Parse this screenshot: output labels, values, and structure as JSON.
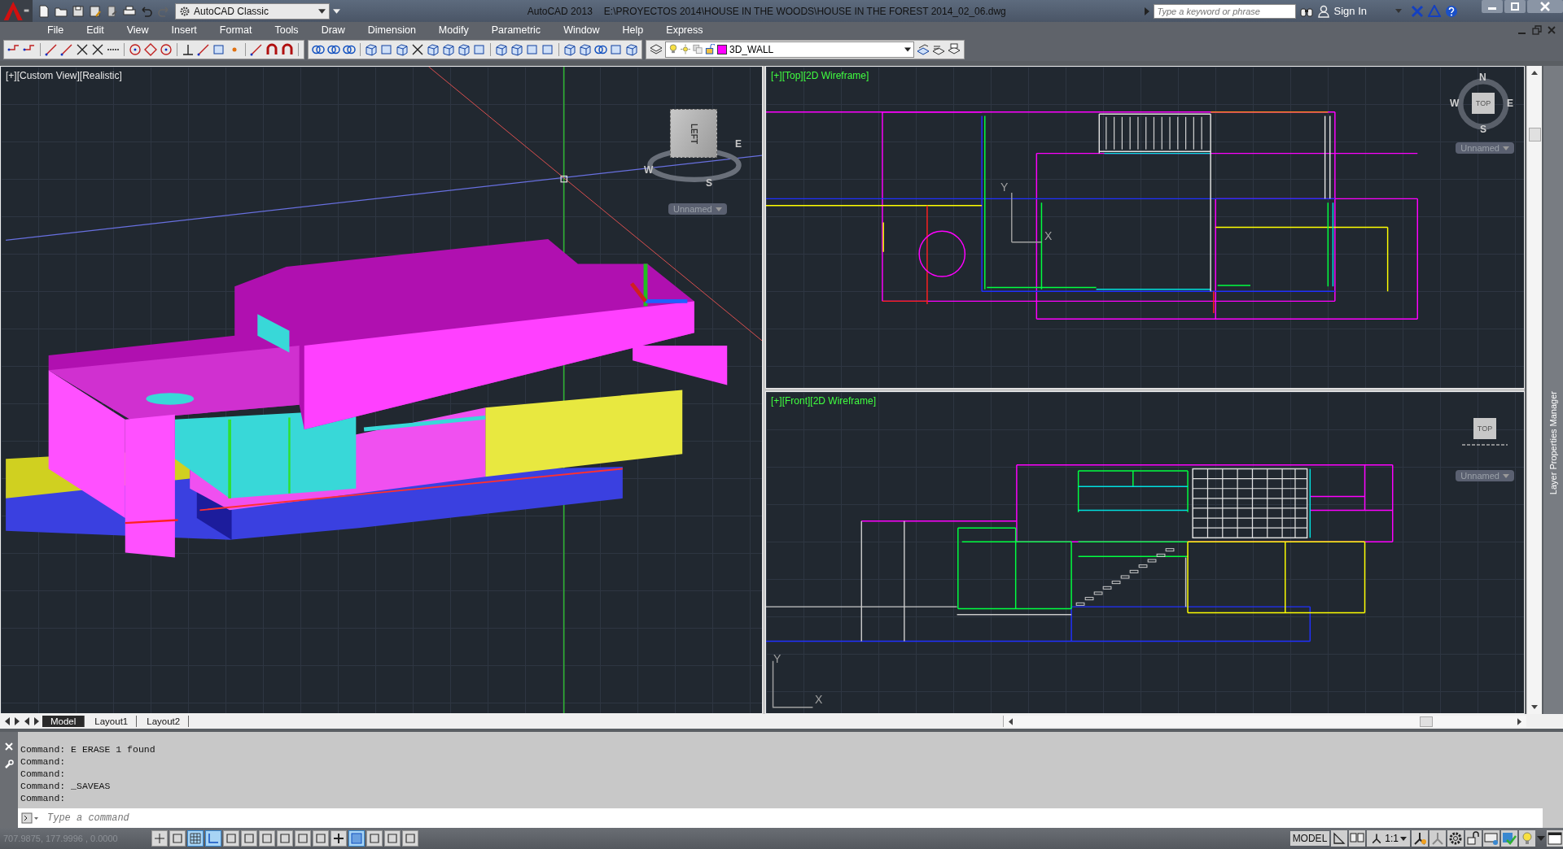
{
  "window": {
    "workspace": "AutoCAD Classic",
    "app_name": "AutoCAD 2013",
    "file_path": "E:\\PROYECTOS 2014\\HOUSE IN THE WOODS\\HOUSE IN THE FOREST 2014_02_06.dwg"
  },
  "search": {
    "placeholder": "Type a keyword or phrase"
  },
  "sign_in": "Sign In",
  "menu": [
    "File",
    "Edit",
    "View",
    "Insert",
    "Format",
    "Tools",
    "Draw",
    "Dimension",
    "Modify",
    "Parametric",
    "Window",
    "Help",
    "Express"
  ],
  "layer": {
    "name": "3D_WALL"
  },
  "viewports": [
    {
      "label": "[+][Custom View][Realistic]",
      "cube_face": "LEFT",
      "compass": [
        "W",
        "S",
        "E"
      ],
      "named_view": "Unnamed"
    },
    {
      "label": "[+][Top][2D Wireframe]",
      "cube_face": "TOP",
      "compass": [
        "N",
        "W",
        "E",
        "S"
      ],
      "named_view": "Unnamed",
      "ucs": {
        "x": "X",
        "y": "Y"
      }
    },
    {
      "label": "[+][Front][2D Wireframe]",
      "cube_face": "TOP",
      "named_view": "Unnamed",
      "ucs": {
        "x": "X",
        "y": "Y"
      }
    }
  ],
  "layout_tabs": [
    {
      "label": "Model",
      "selected": true
    },
    {
      "label": "Layout1",
      "selected": false
    },
    {
      "label": "Layout2",
      "selected": false
    }
  ],
  "command_history": [
    "Command: E ERASE 1 found",
    "Command:",
    "Command:",
    "Command: _SAVEAS",
    "Command:"
  ],
  "command_input": {
    "placeholder": "Type a command"
  },
  "status": {
    "coordinates": "707.9875, 177.9996 , 0.0000",
    "space": "MODEL",
    "scale": "1:1"
  },
  "status_toggles": [
    {
      "on": false
    },
    {
      "on": false
    },
    {
      "on": true
    },
    {
      "on": true
    },
    {
      "on": false
    },
    {
      "on": false
    },
    {
      "on": false
    },
    {
      "on": false
    },
    {
      "on": false
    },
    {
      "on": false
    },
    {
      "on": false
    },
    {
      "on": true
    },
    {
      "on": false
    },
    {
      "on": false
    },
    {
      "on": false
    }
  ],
  "palette_title": "Layer Properties Manager"
}
